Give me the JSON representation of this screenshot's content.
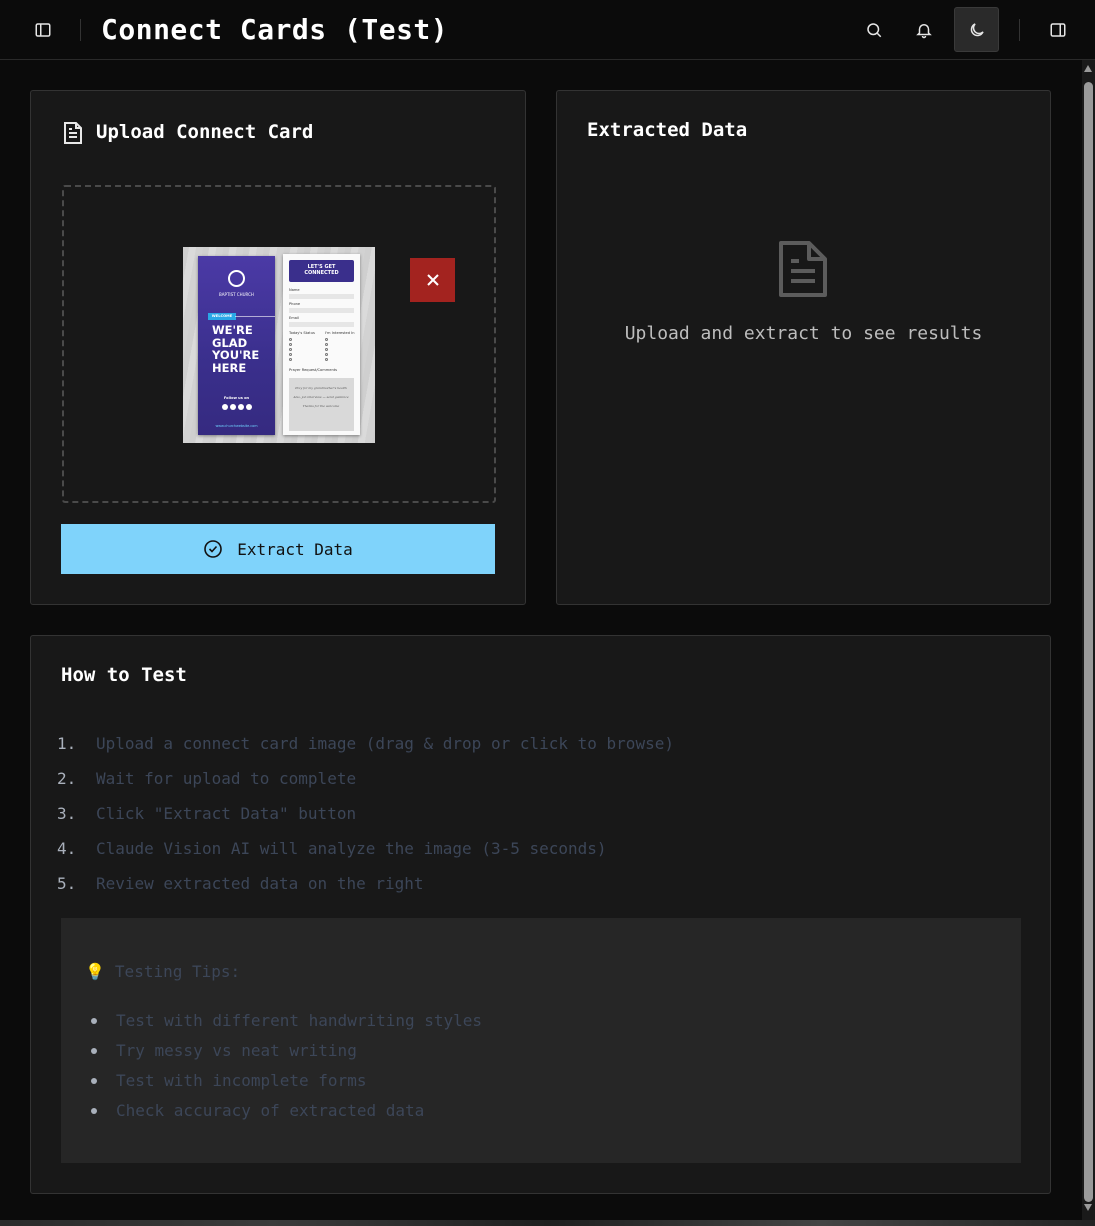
{
  "header": {
    "title": "Connect Cards (Test)",
    "icons": {
      "sidebar": "sidebar-toggle-icon",
      "search": "search-icon",
      "bell": "bell-icon",
      "theme": "moon-icon",
      "panel": "right-panel-icon"
    }
  },
  "upload": {
    "title": "Upload Connect Card",
    "remove_icon": "close-icon",
    "extract_label": "Extract Data",
    "preview": {
      "front": {
        "logo": "Logo",
        "church": "BAPTIST CHURCH",
        "welcome": "WELCOME",
        "headline": "WE'RE\nGLAD\nYOU'RE\nHERE",
        "follow": "Follow us on",
        "url": "www.churchwebsite.com"
      },
      "back": {
        "heading": "LET'S GET\nCONNECTED",
        "name_label": "Name",
        "name_value": "Sarah Brandt",
        "phone_label": "Phone",
        "phone_value": "512 · 633 · 2003",
        "email_label": "Email",
        "email_value": "sarahbrandt@gmail.com",
        "status_label": "Today's Status",
        "interest_label": "I'm Interested In",
        "status_options": [
          "First Visit",
          "Second Visit",
          "Regular Attendee",
          "Member",
          "Other"
        ],
        "interest_options": [
          "Membership",
          "Baptism",
          "Service",
          "Volunteering",
          "Other"
        ],
        "comments_label": "Prayer Request/Comments",
        "comments": [
          "Pray for my grandmother's health",
          "Also, job interview — send guidance",
          "Thanks for the welcome"
        ]
      }
    }
  },
  "extracted": {
    "title": "Extracted Data",
    "empty_icon": "document-icon",
    "empty_text": "Upload and extract to see results"
  },
  "howto": {
    "title": "How to Test",
    "steps": [
      {
        "num": "1.",
        "text": "Upload a connect card image (drag & drop or click to browse)"
      },
      {
        "num": "2.",
        "text": "Wait for upload to complete"
      },
      {
        "num": "3.",
        "text": "Click \"Extract Data\" button"
      },
      {
        "num": "4.",
        "text": "Claude Vision AI will analyze the image (3-5 seconds)"
      },
      {
        "num": "5.",
        "text": "Review extracted data on the right"
      }
    ],
    "tips": {
      "icon": "💡",
      "title": "Testing Tips:",
      "items": [
        "Test with different handwriting styles",
        "Try messy vs neat writing",
        "Test with incomplete forms",
        "Check accuracy of extracted data"
      ]
    }
  },
  "colors": {
    "background": "#0b0b0b",
    "card": "#181818",
    "accent_button": "#7fd3fb",
    "danger": "#a3231f",
    "muted_text": "#3c4658"
  }
}
